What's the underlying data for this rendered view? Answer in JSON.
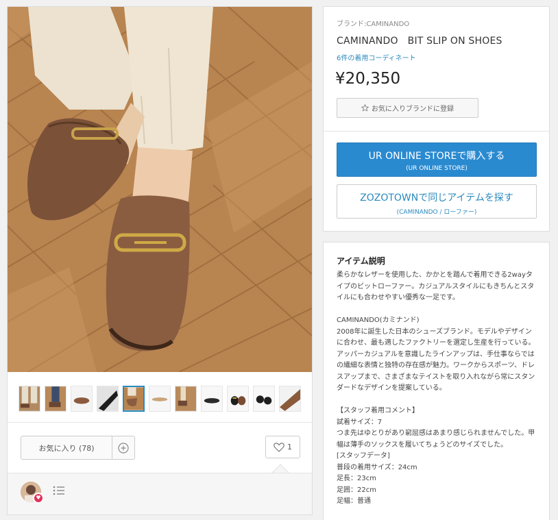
{
  "product": {
    "brand_label": "ブランド:CAMINANDO",
    "title": "CAMINANDO   BIT SLIP ON SHOES",
    "coordinate_link": "6件の着用コーディネート",
    "price": "¥20,350",
    "brand_fav_label": "お気に入りブランドに登録",
    "buy_button": {
      "main": "UR ONLINE STOREで購入する",
      "sub": "(UR ONLINE STORE)"
    },
    "zozo_button": {
      "main": "ZOZOTOWNで同じアイテムを探す",
      "sub": "(CAMINANDO / ローファー)"
    }
  },
  "gallery": {
    "thumbnail_count": 11,
    "active_index": 4
  },
  "actions": {
    "favorite_label": "お気に入り (78)",
    "like_count": "1"
  },
  "description": {
    "heading": "アイテム説明",
    "paragraphs": [
      "柔らかなレザーを使用した、かかとを踏んで着用できる2wayタイプのビットローファー。カジュアルスタイルにもきちんとスタイルにも合わせやすい優秀な一足です。",
      "",
      "CAMINANDO(カミナンド)",
      "2008年に誕生した日本のシューズブランド。モデルやデザインに合わせ、最も適したファクトリーを選定し生産を行っている。アッパーカジュアルを意識したラインアップは、手仕事ならではの繊細な表情と独特の存在感が魅力。ワークからスポーツ、ドレスアップまで、さまざまなテイストを取り入れながら常にスタンダードなデザインを提案している。",
      "",
      "【スタッフ着用コメント】",
      "試着サイズ：7",
      "つま先はゆとりがあり窮屈感はあまり感じられませんでした。甲幅は薄手のソックスを履いてちょうどのサイズでした。",
      "[スタッフデータ]",
      "普段の着用サイズ：24cm",
      "足長：23cm",
      "足囲：22cm",
      "足幅：普通"
    ]
  },
  "colors": {
    "accent_blue": "#2a8ad0",
    "link_blue": "#2a8abf",
    "heart_pink": "#e0325a"
  }
}
